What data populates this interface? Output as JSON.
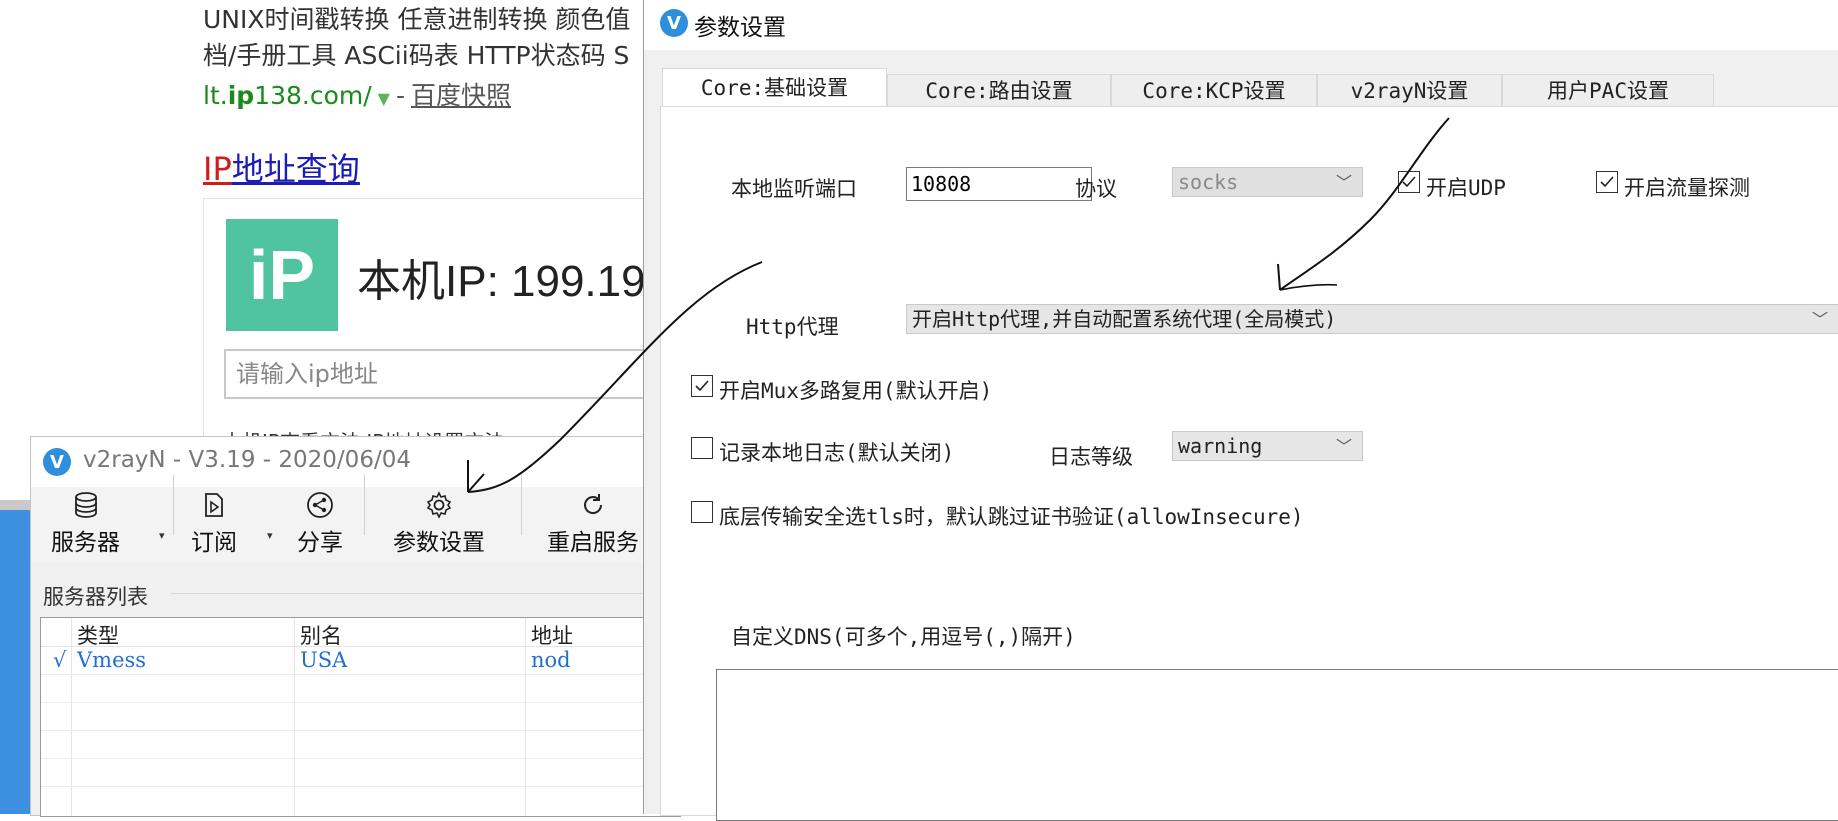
{
  "web": {
    "line1": "UNIX时间戳转换 任意进制转换 颜色值",
    "line2": "档/手册工具 ASCii码表 HTTP状态码 S",
    "url_green": "lt.",
    "url_bold": "ip",
    "url_rest": "138.com/",
    "url_sep": "-",
    "snapshot": "百度快照",
    "ip_title_red": "IP",
    "ip_title_blue": "地址查询",
    "logo_text": "iP",
    "ip_value": "本机IP: 199.19",
    "ip_input_placeholder": "请输入ip地址",
    "hint": "本机IP查看方法  IP地址设置方法"
  },
  "main_window": {
    "title": "v2rayN - V3.19 - 2020/06/04",
    "toolbar": {
      "servers": "服务器",
      "subscribe": "订阅",
      "share": "分享",
      "settings": "参数设置",
      "restart": "重启服务"
    },
    "list_label": "服务器列表",
    "columns": [
      "类型",
      "别名",
      "地址"
    ],
    "rows": [
      {
        "check": "√",
        "type": "Vmess",
        "alias": "USA",
        "address": "nod"
      }
    ]
  },
  "settings_dialog": {
    "title": "参数设置",
    "tabs": [
      "Core:基础设置",
      "Core:路由设置",
      "Core:KCP设置",
      "v2rayN设置",
      "用户PAC设置"
    ],
    "local_port_label": "本地监听端口",
    "local_port_value": "10808",
    "protocol_label": "协议",
    "protocol_value": "socks",
    "udp_label": "开启UDP",
    "udp_checked": true,
    "sniff_label": "开启流量探测",
    "sniff_checked": true,
    "http_proxy_label": "Http代理",
    "http_proxy_value": "开启Http代理,并自动配置系统代理(全局模式)",
    "mux_label": "开启Mux多路复用(默认开启)",
    "mux_checked": true,
    "log_label": "记录本地日志(默认关闭)",
    "log_checked": false,
    "log_level_label": "日志等级",
    "log_level_value": "warning",
    "allow_insecure_label": "底层传输安全选tls时，默认跳过证书验证(allowInsecure)",
    "allow_insecure_checked": false,
    "dns_label": "自定义DNS(可多个,用逗号(,)隔开)",
    "dns_value": ""
  },
  "icons": {
    "app": "v2rayn-logo-icon",
    "servers": "database-icon",
    "subscribe": "subscribe-icon",
    "share": "share-icon",
    "settings": "gear-icon",
    "restart": "refresh-icon",
    "checkbox": "checkmark-icon",
    "dropdown": "chevron-down-icon"
  },
  "colors": {
    "accent_blue": "#2f8fdc",
    "ip_logo_green": "#4fc49f",
    "link_blue": "#1c1cb8",
    "link_red": "#d21c1c",
    "url_green": "#1a8a1a",
    "server_row_blue": "#1f6fd0"
  }
}
